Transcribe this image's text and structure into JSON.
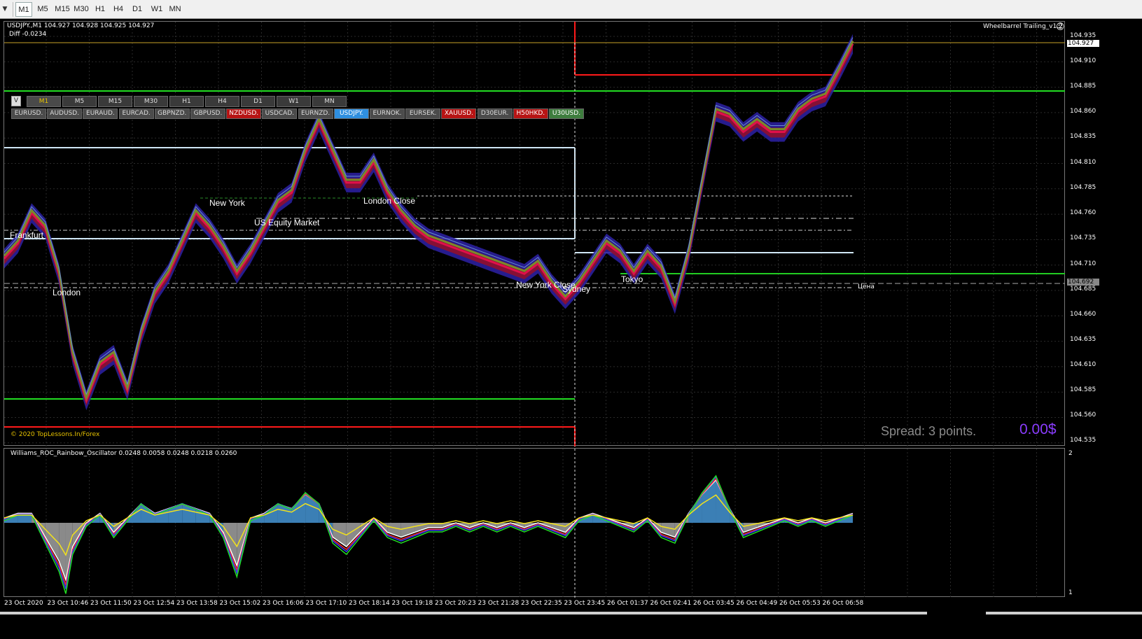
{
  "toolbar": {
    "timeframes": [
      "M1",
      "M5",
      "M15",
      "M30",
      "H1",
      "H4",
      "D1",
      "W1",
      "MN"
    ],
    "active": "M1"
  },
  "chart": {
    "symbol_line": "USDJPY.,M1  104.927 104.928 104.925 104.927",
    "diff": "Diff -0.0234",
    "ea_name": "Wheelbarrel Trailing_v1.2",
    "copyright": "© 2020 TopLessons.In/Forex",
    "spread": "Spread: 3 points.",
    "profit": "0.00$",
    "price_axis": [
      "104.935",
      "104.910",
      "104.885",
      "104.860",
      "104.835",
      "104.810",
      "104.785",
      "104.760",
      "104.735",
      "104.710",
      "104.685",
      "104.660",
      "104.635",
      "104.610",
      "104.585",
      "104.560",
      "104.535"
    ],
    "current_price": "104.927",
    "line_price": "104.692",
    "line_label": "Цена",
    "sessions": {
      "frankfurt": "Frankfurt",
      "london": "London",
      "new_york": "New York",
      "us_equity": "US Equity Market",
      "london_close": "London Close",
      "new_york_close": "New York Close",
      "sydney": "Sydney",
      "tokyo": "Tokyo"
    }
  },
  "tf_panel": {
    "v_label": "V",
    "timeframes": [
      "M1",
      "M5",
      "M15",
      "M30",
      "H1",
      "H4",
      "D1",
      "W1",
      "MN"
    ],
    "selected": "M1",
    "symbols": [
      {
        "label": "EURUSD.",
        "state": "normal"
      },
      {
        "label": "AUDUSD.",
        "state": "normal"
      },
      {
        "label": "EURAUD.",
        "state": "normal"
      },
      {
        "label": "EURCAD.",
        "state": "normal"
      },
      {
        "label": "GBPNZD.",
        "state": "normal"
      },
      {
        "label": "GBPUSD.",
        "state": "normal"
      },
      {
        "label": "NZDUSD.",
        "state": "red"
      },
      {
        "label": "USDCAD.",
        "state": "normal"
      },
      {
        "label": "EURNZD.",
        "state": "normal"
      },
      {
        "label": "USDJPY.",
        "state": "blue"
      },
      {
        "label": "EURNOK.",
        "state": "normal"
      },
      {
        "label": "EURSEK.",
        "state": "normal"
      },
      {
        "label": "XAUUSD.",
        "state": "red"
      },
      {
        "label": "D30EUR.",
        "state": "normal"
      },
      {
        "label": "H50HKD.",
        "state": "red"
      },
      {
        "label": "U30USD.",
        "state": "green"
      }
    ]
  },
  "oscillator": {
    "title": "Williams_ROC_Rainbow_Oscillator 0.0248 0.0058 0.0248 0.0218 0.0260",
    "scale_top": "2",
    "scale_bottom": "1"
  },
  "time_axis": [
    "23 Oct 2020",
    "23 Oct 10:46",
    "23 Oct 11:50",
    "23 Oct 12:54",
    "23 Oct 13:58",
    "23 Oct 15:02",
    "23 Oct 16:06",
    "23 Oct 17:10",
    "23 Oct 18:14",
    "23 Oct 19:18",
    "23 Oct 20:23",
    "23 Oct 21:28",
    "23 Oct 22:35",
    "23 Oct 23:45",
    "26 Oct 01:37",
    "26 Oct 02:41",
    "26 Oct 03:45",
    "26 Oct 04:49",
    "26 Oct 05:53",
    "26 Oct 06:58"
  ],
  "colors": {
    "bull": "#7a8a2a",
    "bear": "#8b1030",
    "band_blue": "#2a1f9c",
    "band_red": "#e0104a",
    "green_line": "#22dd22",
    "red_line": "#ff1a1a",
    "lightblue_line": "#cfe6f5",
    "osc_fill_pos": "#3b7fb5",
    "osc_fill_neg": "#8a8a8a"
  },
  "price_series": [
    {
      "t": 0,
      "v": 104.715
    },
    {
      "t": 2,
      "v": 104.73
    },
    {
      "t": 4,
      "v": 104.76
    },
    {
      "t": 6,
      "v": 104.745
    },
    {
      "t": 8,
      "v": 104.7
    },
    {
      "t": 10,
      "v": 104.62
    },
    {
      "t": 12,
      "v": 104.575
    },
    {
      "t": 14,
      "v": 104.61
    },
    {
      "t": 16,
      "v": 104.62
    },
    {
      "t": 18,
      "v": 104.585
    },
    {
      "t": 20,
      "v": 104.64
    },
    {
      "t": 22,
      "v": 104.68
    },
    {
      "t": 24,
      "v": 104.7
    },
    {
      "t": 26,
      "v": 104.73
    },
    {
      "t": 28,
      "v": 104.76
    },
    {
      "t": 30,
      "v": 104.745
    },
    {
      "t": 32,
      "v": 104.725
    },
    {
      "t": 34,
      "v": 104.7
    },
    {
      "t": 36,
      "v": 104.72
    },
    {
      "t": 38,
      "v": 104.745
    },
    {
      "t": 40,
      "v": 104.77
    },
    {
      "t": 42,
      "v": 104.78
    },
    {
      "t": 44,
      "v": 104.82
    },
    {
      "t": 46,
      "v": 104.85
    },
    {
      "t": 48,
      "v": 104.82
    },
    {
      "t": 50,
      "v": 104.79
    },
    {
      "t": 52,
      "v": 104.79
    },
    {
      "t": 54,
      "v": 104.81
    },
    {
      "t": 56,
      "v": 104.78
    },
    {
      "t": 58,
      "v": 104.76
    },
    {
      "t": 60,
      "v": 104.745
    },
    {
      "t": 62,
      "v": 104.735
    },
    {
      "t": 64,
      "v": 104.73
    },
    {
      "t": 66,
      "v": 104.725
    },
    {
      "t": 68,
      "v": 104.72
    },
    {
      "t": 70,
      "v": 104.715
    },
    {
      "t": 72,
      "v": 104.71
    },
    {
      "t": 74,
      "v": 104.705
    },
    {
      "t": 76,
      "v": 104.7
    },
    {
      "t": 78,
      "v": 104.71
    },
    {
      "t": 80,
      "v": 104.69
    },
    {
      "t": 82,
      "v": 104.675
    },
    {
      "t": 84,
      "v": 104.69
    },
    {
      "t": 86,
      "v": 104.71
    },
    {
      "t": 88,
      "v": 104.73
    },
    {
      "t": 90,
      "v": 104.72
    },
    {
      "t": 92,
      "v": 104.7
    },
    {
      "t": 94,
      "v": 104.72
    },
    {
      "t": 96,
      "v": 104.705
    },
    {
      "t": 98,
      "v": 104.67
    },
    {
      "t": 100,
      "v": 104.72
    },
    {
      "t": 102,
      "v": 104.79
    },
    {
      "t": 104,
      "v": 104.86
    },
    {
      "t": 106,
      "v": 104.855
    },
    {
      "t": 108,
      "v": 104.84
    },
    {
      "t": 110,
      "v": 104.85
    },
    {
      "t": 112,
      "v": 104.84
    },
    {
      "t": 114,
      "v": 104.84
    },
    {
      "t": 116,
      "v": 104.86
    },
    {
      "t": 118,
      "v": 104.87
    },
    {
      "t": 120,
      "v": 104.875
    },
    {
      "t": 122,
      "v": 104.9
    },
    {
      "t": 124,
      "v": 104.927
    }
  ],
  "osc_series": [
    {
      "t": 0,
      "v": 0.01
    },
    {
      "t": 2,
      "v": 0.02
    },
    {
      "t": 4,
      "v": 0.02
    },
    {
      "t": 6,
      "v": -0.03
    },
    {
      "t": 8,
      "v": -0.08
    },
    {
      "t": 9,
      "v": -0.12
    },
    {
      "t": 10,
      "v": -0.05
    },
    {
      "t": 12,
      "v": 0.0
    },
    {
      "t": 14,
      "v": 0.02
    },
    {
      "t": 16,
      "v": -0.02
    },
    {
      "t": 18,
      "v": 0.01
    },
    {
      "t": 20,
      "v": 0.04
    },
    {
      "t": 22,
      "v": 0.02
    },
    {
      "t": 24,
      "v": 0.03
    },
    {
      "t": 26,
      "v": 0.04
    },
    {
      "t": 28,
      "v": 0.03
    },
    {
      "t": 30,
      "v": 0.02
    },
    {
      "t": 32,
      "v": -0.02
    },
    {
      "t": 34,
      "v": -0.09
    },
    {
      "t": 36,
      "v": 0.01
    },
    {
      "t": 38,
      "v": 0.02
    },
    {
      "t": 40,
      "v": 0.04
    },
    {
      "t": 42,
      "v": 0.03
    },
    {
      "t": 44,
      "v": 0.06
    },
    {
      "t": 46,
      "v": 0.04
    },
    {
      "t": 48,
      "v": -0.03
    },
    {
      "t": 50,
      "v": -0.05
    },
    {
      "t": 52,
      "v": -0.02
    },
    {
      "t": 54,
      "v": 0.01
    },
    {
      "t": 56,
      "v": -0.02
    },
    {
      "t": 58,
      "v": -0.03
    },
    {
      "t": 60,
      "v": -0.02
    },
    {
      "t": 62,
      "v": -0.01
    },
    {
      "t": 64,
      "v": -0.01
    },
    {
      "t": 66,
      "v": 0.0
    },
    {
      "t": 68,
      "v": -0.01
    },
    {
      "t": 70,
      "v": 0.0
    },
    {
      "t": 72,
      "v": -0.01
    },
    {
      "t": 74,
      "v": 0.0
    },
    {
      "t": 76,
      "v": -0.01
    },
    {
      "t": 78,
      "v": 0.0
    },
    {
      "t": 80,
      "v": -0.01
    },
    {
      "t": 82,
      "v": -0.02
    },
    {
      "t": 84,
      "v": 0.01
    },
    {
      "t": 86,
      "v": 0.02
    },
    {
      "t": 88,
      "v": 0.01
    },
    {
      "t": 90,
      "v": 0.0
    },
    {
      "t": 92,
      "v": -0.01
    },
    {
      "t": 94,
      "v": 0.01
    },
    {
      "t": 96,
      "v": -0.02
    },
    {
      "t": 98,
      "v": -0.03
    },
    {
      "t": 100,
      "v": 0.02
    },
    {
      "t": 102,
      "v": 0.06
    },
    {
      "t": 104,
      "v": 0.09
    },
    {
      "t": 106,
      "v": 0.03
    },
    {
      "t": 108,
      "v": -0.02
    },
    {
      "t": 110,
      "v": -0.01
    },
    {
      "t": 112,
      "v": 0.0
    },
    {
      "t": 114,
      "v": 0.01
    },
    {
      "t": 116,
      "v": 0.0
    },
    {
      "t": 118,
      "v": 0.01
    },
    {
      "t": 120,
      "v": 0.0
    },
    {
      "t": 122,
      "v": 0.01
    },
    {
      "t": 124,
      "v": 0.02
    }
  ]
}
